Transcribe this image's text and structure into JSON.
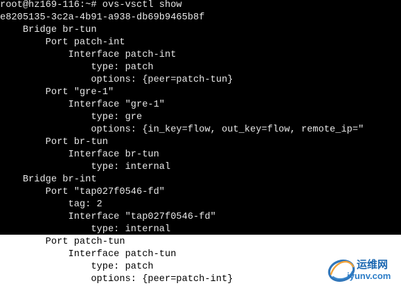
{
  "terminal": {
    "background_dark": "#000000",
    "text_light": "#e8e8e8",
    "background_light": "#ffffff",
    "text_dark": "#000000",
    "lines": [
      "root@hz169-116:~# ovs-vsctl show",
      "e8205135-3c2a-4b91-a938-db69b9465b8f",
      "    Bridge br-tun",
      "        Port patch-int",
      "            Interface patch-int",
      "                type: patch",
      "                options: {peer=patch-tun}",
      "        Port \"gre-1\"",
      "            Interface \"gre-1\"",
      "                type: gre",
      "                options: {in_key=flow, out_key=flow, remote_ip=\"",
      "        Port br-tun",
      "            Interface br-tun",
      "                type: internal",
      "    Bridge br-int",
      "        Port \"tap027f0546-fd\"",
      "            tag: 2",
      "            Interface \"tap027f0546-fd\"",
      "                type: internal",
      "        Port patch-tun",
      "            Interface patch-tun",
      "                type: patch",
      "                options: {peer=patch-int}",
      "                "
    ]
  },
  "watermark": {
    "brand_cn": "运维网",
    "url": "iyunv.com",
    "icon": "swirl-logo-icon",
    "colors": {
      "primary": "#1b67b1",
      "secondary": "#2a7cc7",
      "accent": "#f2a33a"
    }
  }
}
